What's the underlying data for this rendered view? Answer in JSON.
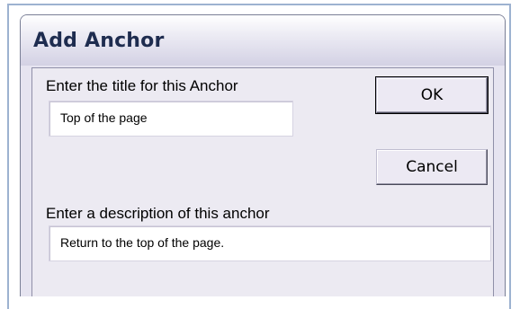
{
  "dialog": {
    "title": "Add Anchor",
    "title_field": {
      "label": "Enter the title for this Anchor",
      "value": "Top of the page"
    },
    "description_field": {
      "label": "Enter a description of this anchor",
      "value": "Return to the top of the page."
    },
    "buttons": {
      "ok": "OK",
      "cancel": "Cancel"
    }
  }
}
